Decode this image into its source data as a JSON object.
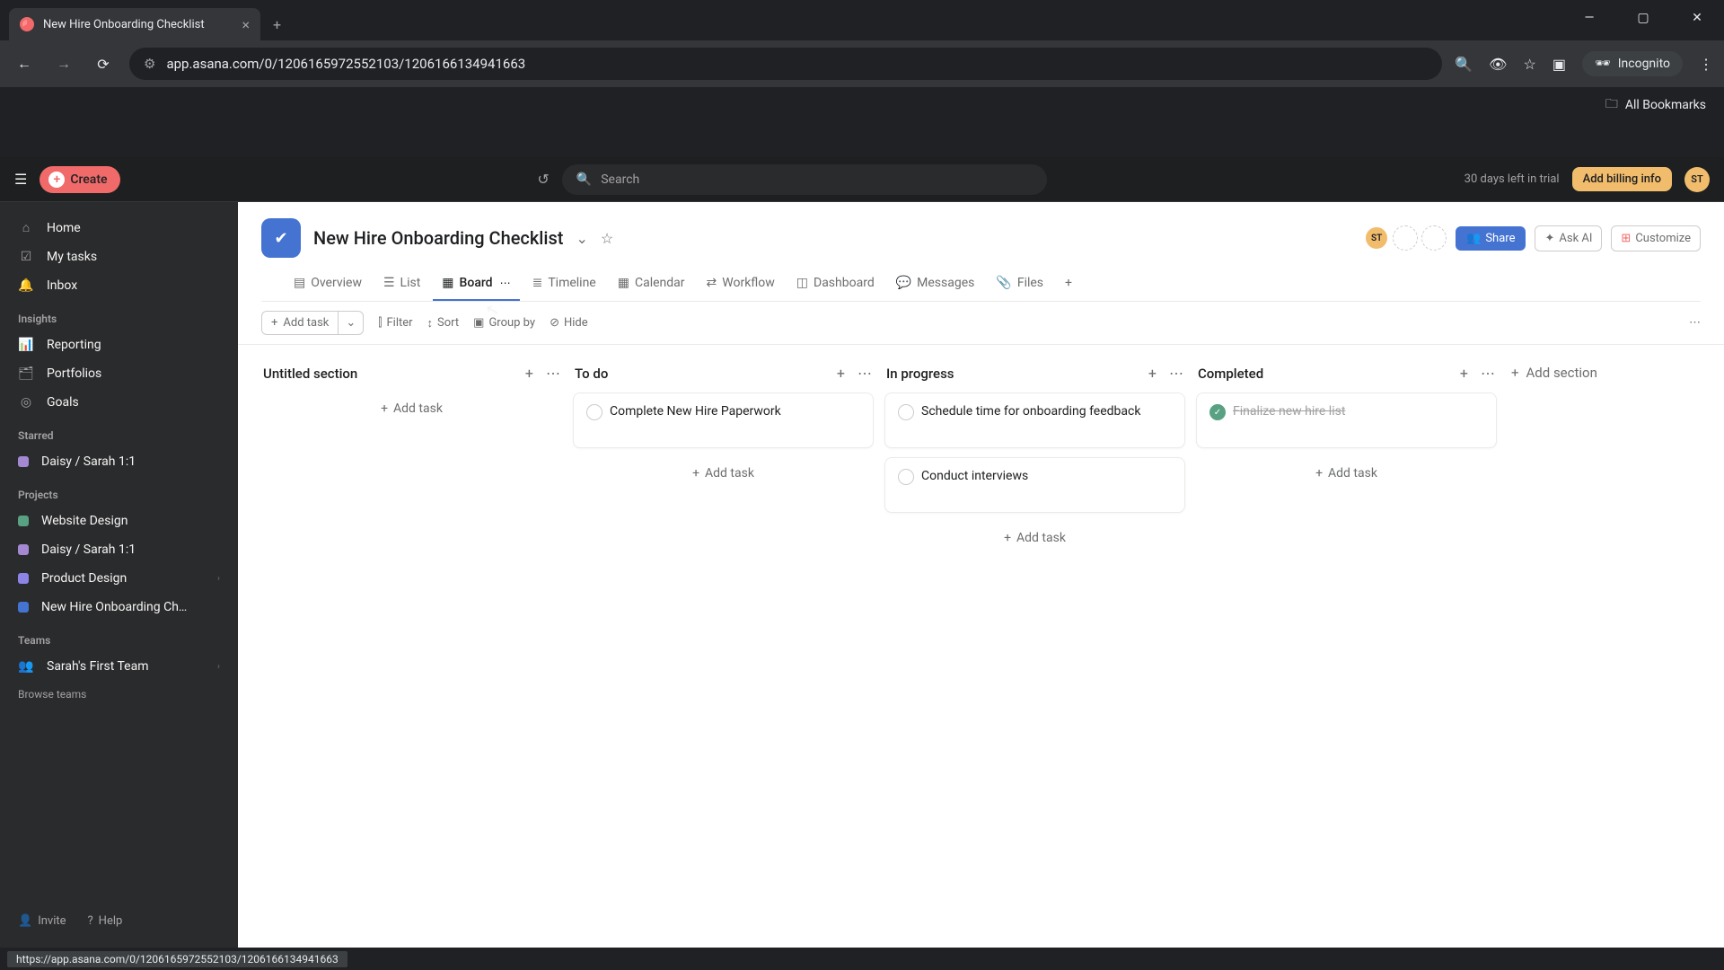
{
  "browser": {
    "tab_title": "New Hire Onboarding Checklist",
    "url": "app.asana.com/0/1206165972552103/1206166134941663",
    "incognito_label": "Incognito",
    "all_bookmarks": "All Bookmarks",
    "status_url": "https://app.asana.com/0/1206165972552103/1206166134941663"
  },
  "topbar": {
    "create": "Create",
    "search_placeholder": "Search",
    "trial_text": "30 days left in trial",
    "billing": "Add billing info",
    "avatar_initials": "ST"
  },
  "sidebar": {
    "home": "Home",
    "mytasks": "My tasks",
    "inbox": "Inbox",
    "insights_heading": "Insights",
    "reporting": "Reporting",
    "portfolios": "Portfolios",
    "goals": "Goals",
    "starred_heading": "Starred",
    "starred_items": [
      {
        "label": "Daisy / Sarah 1:1",
        "color": "#a489d2"
      }
    ],
    "projects_heading": "Projects",
    "projects": [
      {
        "label": "Website Design",
        "color": "#58a182"
      },
      {
        "label": "Daisy / Sarah 1:1",
        "color": "#a489d2"
      },
      {
        "label": "Product Design",
        "color": "#8d84e8",
        "expandable": true
      },
      {
        "label": "New Hire Onboarding Ch…",
        "color": "#4573d2"
      }
    ],
    "teams_heading": "Teams",
    "teams": [
      {
        "label": "Sarah's First Team",
        "expandable": true
      }
    ],
    "browse_teams": "Browse teams",
    "invite": "Invite",
    "help": "Help"
  },
  "project": {
    "title": "New Hire Onboarding Checklist",
    "avatar_initials": "ST",
    "share": "Share",
    "ask_ai": "Ask AI",
    "customize": "Customize"
  },
  "tabs": {
    "overview": "Overview",
    "list": "List",
    "board": "Board",
    "timeline": "Timeline",
    "calendar": "Calendar",
    "workflow": "Workflow",
    "dashboard": "Dashboard",
    "messages": "Messages",
    "files": "Files"
  },
  "toolbar": {
    "add_task": "Add task",
    "filter": "Filter",
    "sort": "Sort",
    "group_by": "Group by",
    "hide": "Hide"
  },
  "board": {
    "add_task_label": "Add task",
    "add_section": "Add section",
    "columns": [
      {
        "title": "Untitled section",
        "cards": []
      },
      {
        "title": "To do",
        "cards": [
          {
            "text": "Complete New Hire Paperwork",
            "done": false
          }
        ]
      },
      {
        "title": "In progress",
        "cards": [
          {
            "text": "Schedule time for onboarding feedback",
            "done": false
          },
          {
            "text": "Conduct interviews",
            "done": false
          }
        ]
      },
      {
        "title": "Completed",
        "cards": [
          {
            "text": "Finalize new hire list",
            "done": true
          }
        ]
      }
    ]
  }
}
